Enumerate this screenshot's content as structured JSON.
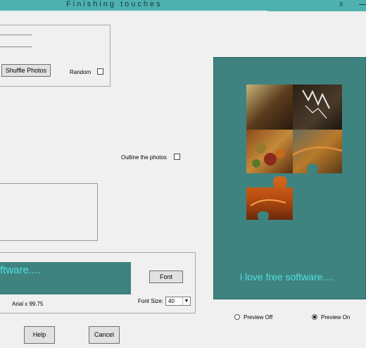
{
  "window": {
    "title": "Finishing touches",
    "close": "x"
  },
  "photos_group": {
    "shuffle_label": "Shuffle Photos",
    "random_label": "Random"
  },
  "outline_label": "Outline the photos",
  "font_group": {
    "preview_text": "ftware....",
    "font_info": "Arial x  99.75",
    "font_button": "Font",
    "font_size_label": "Font Size:",
    "font_size_value": "40",
    "font_size_arrow": "▼"
  },
  "preview": {
    "text": "i love free software...."
  },
  "preview_options": {
    "off_label": "Preview Off",
    "on_label": "Preview On",
    "selected": "on"
  },
  "footer": {
    "help_label": "Help",
    "cancel_label": "Cancel"
  },
  "colors": {
    "titlebar": "#4fb0b0",
    "preview_bg": "#3f8380",
    "preview_text": "#4fe0e0"
  }
}
